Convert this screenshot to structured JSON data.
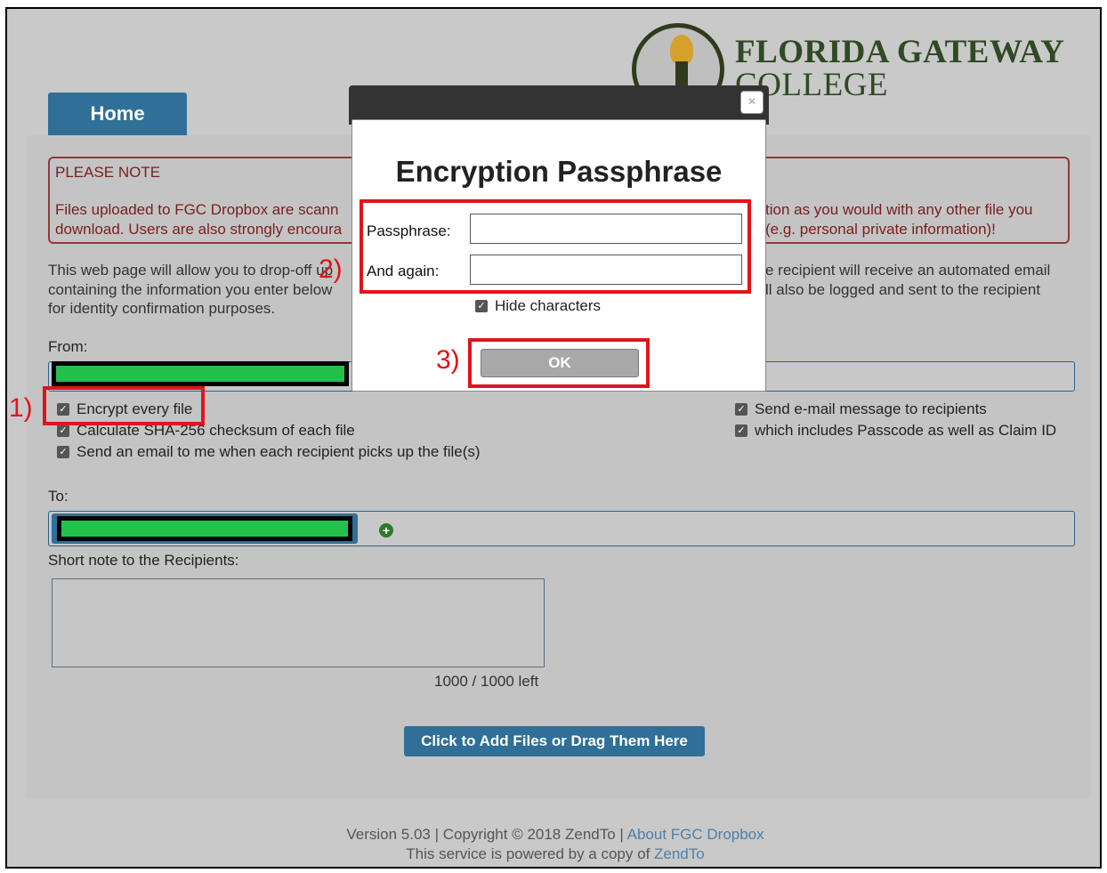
{
  "logo": {
    "line1": "FLORIDA GATEWAY",
    "line2": "COLLEGE"
  },
  "tabs": {
    "home": "Home"
  },
  "notice": {
    "title": "PLEASE NOTE",
    "left_line1": "Files uploaded to FGC Dropbox are scann",
    "left_line2": "download. Users are also strongly encoura",
    "right_line1": "tion as you would with any other file you",
    "right_line2": "(e.g. personal private information)!"
  },
  "intro": {
    "left_a": "This web page will allow you to drop-off up",
    "left_b": "containing the information you enter below",
    "left_c": "for identity confirmation purposes.",
    "right_a": "e recipient will receive an automated email",
    "right_b": "ll also be logged and sent to the recipient"
  },
  "form": {
    "from_label": "From:",
    "to_label": "To:",
    "note_label": "Short note to the Recipients:",
    "counter": "1000 / 1000 left",
    "add_files_label": "Click to Add Files or Drag Them Here",
    "options_left": [
      {
        "label": "Encrypt every file",
        "checked": true
      },
      {
        "label": "Calculate SHA-256 checksum of each file",
        "checked": true
      },
      {
        "label": "Send an email to me when each recipient picks up the file(s)",
        "checked": true
      }
    ],
    "options_right": [
      {
        "label": "Send e-mail message to recipients",
        "checked": true
      },
      {
        "label": "which includes Passcode as well as Claim ID",
        "checked": true
      }
    ]
  },
  "footer": {
    "line1_prefix": "Version 5.03 | Copyright © 2018 ZendTo | ",
    "line1_link": "About FGC Dropbox",
    "line2_prefix": "This service is powered by a copy of ",
    "line2_link": "ZendTo"
  },
  "modal": {
    "title": "Encryption Passphrase",
    "passphrase_label": "Passphrase:",
    "again_label": "And again:",
    "passphrase_value": "",
    "again_value": "",
    "hide_characters_label": "Hide characters",
    "hide_characters_checked": true,
    "ok_label": "OK",
    "close_glyph": "×"
  },
  "annotations": {
    "step1": "1)",
    "step2": "2)",
    "step3": "3)",
    "color": "#e0141c"
  },
  "colors": {
    "brand_blue": "#2f6f98",
    "redaction_green": "#23c14b",
    "logo_green": "#2f4a24"
  },
  "icons": {
    "checkbox": "checkbox-checked-icon",
    "add_recipient": "plus-circle-icon",
    "close": "close-icon"
  }
}
